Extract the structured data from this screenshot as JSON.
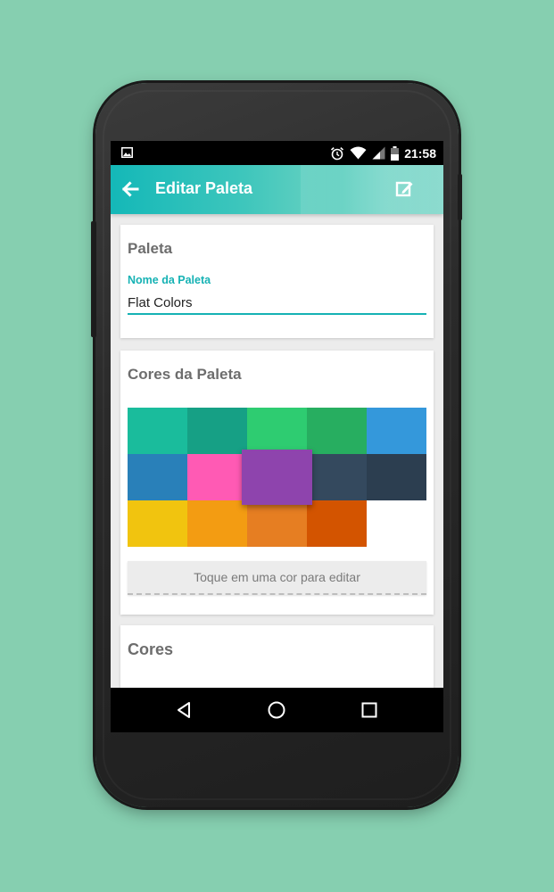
{
  "status_bar": {
    "time": "21:58",
    "icons": [
      "image-icon",
      "alarm-icon",
      "wifi-icon",
      "signal-icon",
      "battery-icon"
    ]
  },
  "app_bar": {
    "title": "Editar Paleta",
    "back_icon": "arrow-left-icon",
    "action_icon": "edit-icon"
  },
  "palette_card": {
    "title": "Paleta",
    "name_label": "Nome da Paleta",
    "name_value": "Flat Colors"
  },
  "colors_card": {
    "title": "Cores da Paleta",
    "swatches": [
      "#1abc9c",
      "#16a085",
      "#2ecc71",
      "#27ae60",
      "#3498db",
      "#2980b9",
      "#ff5ab4",
      "#8e44ad",
      "#34495e",
      "#2c3e50",
      "#f1c40f",
      "#f39c12",
      "#e67e22",
      "#d35400"
    ],
    "selected_index": 7,
    "hint": "Toque em uma cor para editar"
  },
  "cores_card": {
    "title": "Cores"
  },
  "accent_color": "#16b2b4",
  "nav_bar": {
    "icons": [
      "back-triangle-icon",
      "home-circle-icon",
      "recents-square-icon"
    ]
  }
}
